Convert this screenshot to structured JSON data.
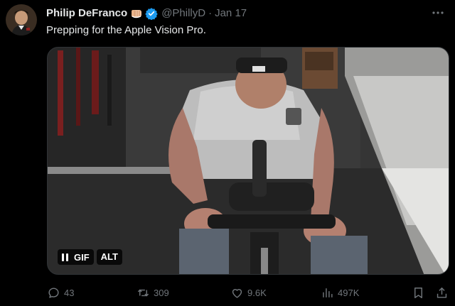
{
  "author": {
    "display_name": "Philip DeFranco",
    "handle": "@PhillyD",
    "separator": "·",
    "date": "Jan 17",
    "emoji_icon": "raised-fist-emoji",
    "verified_icon": "verified-badge-icon",
    "verified_color": "#1d9bf0"
  },
  "tweet": {
    "text": "Prepping for the Apple Vision Pro."
  },
  "media": {
    "gif_label": "GIF",
    "alt_label": "ALT",
    "pause_icon": "pause-icon"
  },
  "actions": {
    "reply_count": "43",
    "retweet_count": "309",
    "like_count": "9.6K",
    "views_count": "497K"
  },
  "colors": {
    "background": "#000000",
    "primary_text": "#e7e9ea",
    "secondary_text": "#71767b"
  }
}
